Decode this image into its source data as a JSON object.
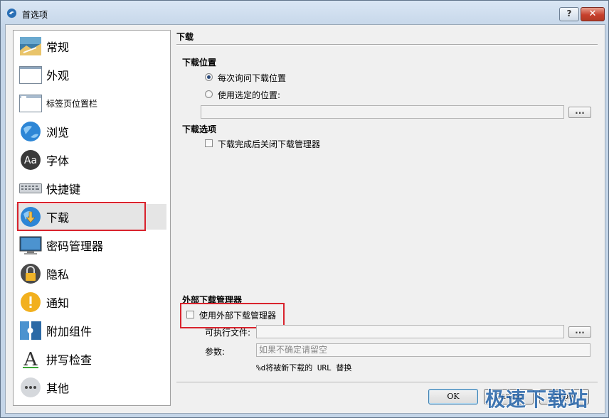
{
  "window": {
    "title": "首选项",
    "help_label": "?",
    "close_label": "✕"
  },
  "sidebar": {
    "items": [
      {
        "label": "常规",
        "icon": "general-settings-icon"
      },
      {
        "label": "外观",
        "icon": "appearance-window-icon"
      },
      {
        "label": "标签页位置栏",
        "icon": "tab-bar-icon"
      },
      {
        "label": "浏览",
        "icon": "globe-browse-icon"
      },
      {
        "label": "字体",
        "icon": "font-aa-icon"
      },
      {
        "label": "快捷键",
        "icon": "keyboard-icon"
      },
      {
        "label": "下载",
        "icon": "download-globe-icon",
        "selected": true
      },
      {
        "label": "密码管理器",
        "icon": "monitor-password-icon"
      },
      {
        "label": "隐私",
        "icon": "privacy-lock-icon"
      },
      {
        "label": "通知",
        "icon": "notification-exclamation-icon"
      },
      {
        "label": "附加组件",
        "icon": "addon-puzzle-icon"
      },
      {
        "label": "拼写检查",
        "icon": "spellcheck-a-icon"
      },
      {
        "label": "其他",
        "icon": "more-dots-icon"
      }
    ]
  },
  "content": {
    "page_title": "下载",
    "download_location": {
      "heading": "下载位置",
      "ask_each_time": "每次询问下载位置",
      "use_selected": "使用选定的位置:",
      "path_value": "",
      "browse_label": "..."
    },
    "download_options": {
      "heading": "下载选项",
      "close_manager": "下载完成后关闭下载管理器"
    },
    "external_manager": {
      "heading": "外部下载管理器",
      "use_external": "使用外部下载管理器",
      "executable_label": "可执行文件:",
      "executable_value": "",
      "browse_label": "...",
      "params_label": "参数:",
      "params_placeholder": "如果不确定请留空",
      "hint": "%d将被新下载的 URL 替换"
    }
  },
  "buttons": {
    "ok": "OK",
    "cancel": "Cancel",
    "apply": "Apply"
  },
  "watermark": "极速下载站",
  "colors": {
    "highlight": "#d9232d",
    "accent": "#1d5fa8"
  }
}
